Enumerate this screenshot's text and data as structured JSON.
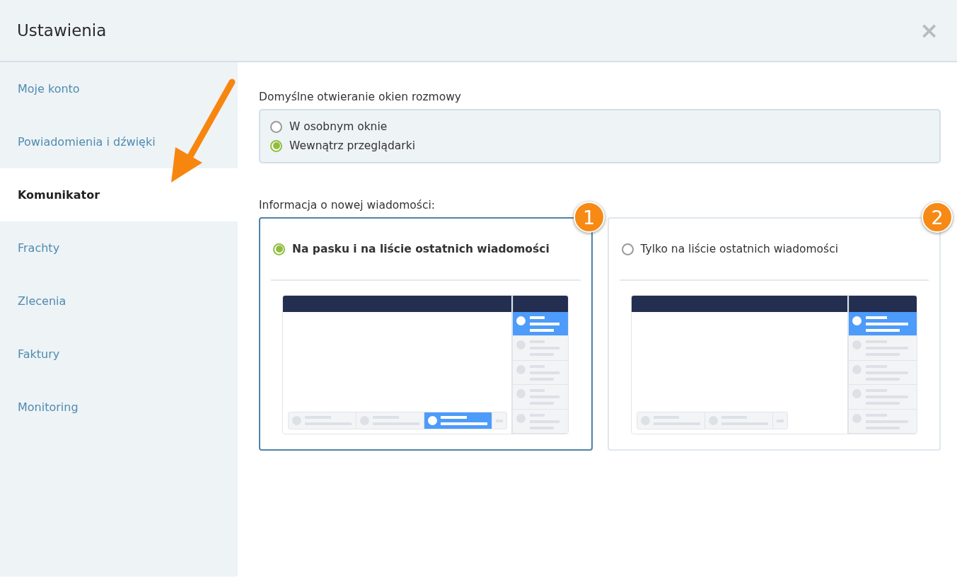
{
  "window": {
    "title": "Ustawienia",
    "close_label": "×"
  },
  "sidebar": {
    "items": [
      {
        "label": "Moje konto",
        "selected": false
      },
      {
        "label": "Powiadomienia i dźwięki",
        "selected": false
      },
      {
        "label": "Komunikator",
        "selected": true
      },
      {
        "label": "Frachty",
        "selected": false
      },
      {
        "label": "Zlecenia",
        "selected": false
      },
      {
        "label": "Faktury",
        "selected": false
      },
      {
        "label": "Monitoring",
        "selected": false
      }
    ]
  },
  "chat_window_group": {
    "label": "Domyślne otwieranie okien rozmowy",
    "options": [
      {
        "label": "W osobnym oknie",
        "selected": false
      },
      {
        "label": "Wewnątrz przeglądarki",
        "selected": true
      }
    ]
  },
  "new_message_group": {
    "label": "Informacja o nowej wiadomości:",
    "options": [
      {
        "label": "Na pasku i na liście ostatnich wiadomości",
        "selected": true,
        "callout": "1",
        "taskbar_highlight": true
      },
      {
        "label": "Tylko na liście ostatnich wiadomości",
        "selected": false,
        "callout": "2",
        "taskbar_highlight": false
      }
    ]
  }
}
